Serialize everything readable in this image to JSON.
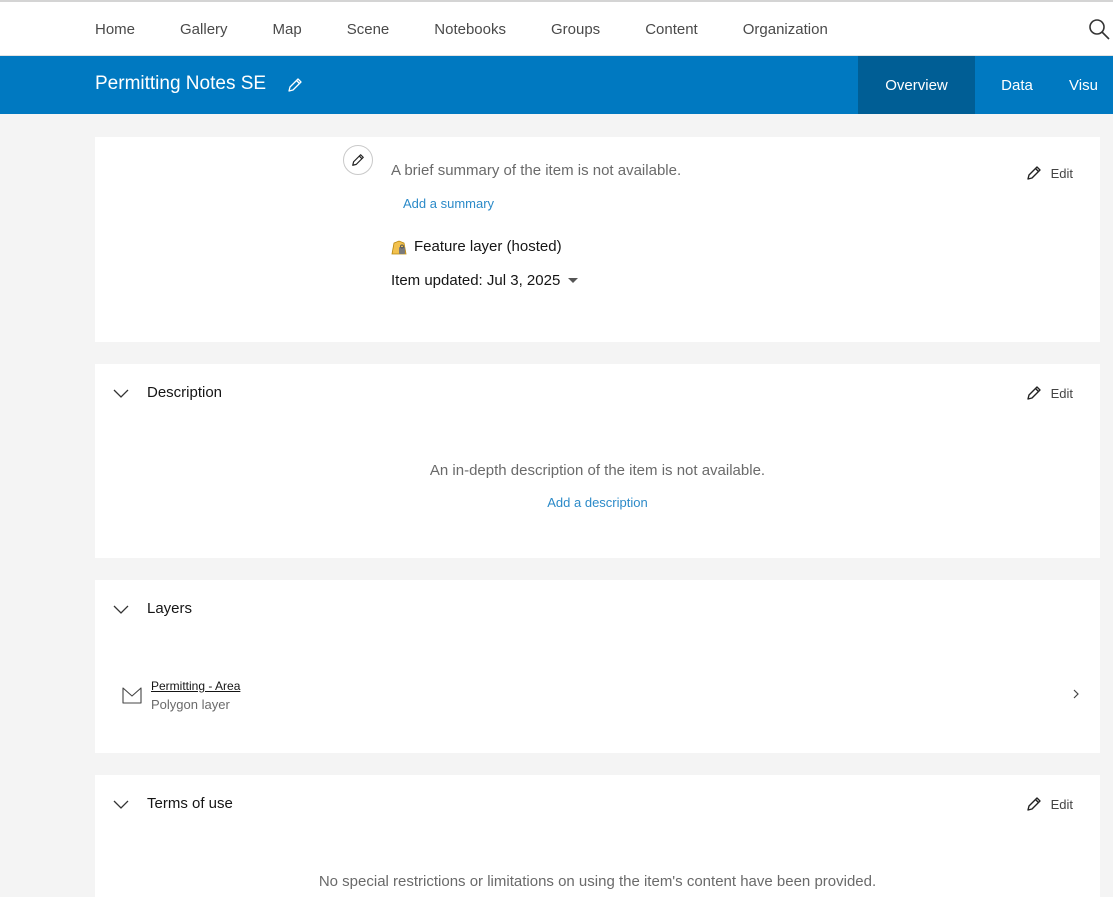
{
  "nav": {
    "items": [
      "Home",
      "Gallery",
      "Map",
      "Scene",
      "Notebooks",
      "Groups",
      "Content",
      "Organization"
    ]
  },
  "item_header": {
    "title": "Permitting Notes SE",
    "tabs": [
      "Overview",
      "Data",
      "Visu"
    ]
  },
  "summary": {
    "text": "A brief summary of the item is not available.",
    "add_link": "Add a summary",
    "item_type": "Feature layer (hosted)",
    "updated": "Item updated: Jul 3, 2025",
    "edit_label": "Edit"
  },
  "description": {
    "heading": "Description",
    "text": "An in-depth description of the item is not available.",
    "add_link": "Add a description",
    "edit_label": "Edit"
  },
  "layers": {
    "heading": "Layers",
    "items": [
      {
        "name": "Permitting - Area",
        "type": "Polygon layer"
      }
    ]
  },
  "terms": {
    "heading": "Terms of use",
    "text": "No special restrictions or limitations on using the item's content have been provided.",
    "edit_label": "Edit"
  }
}
